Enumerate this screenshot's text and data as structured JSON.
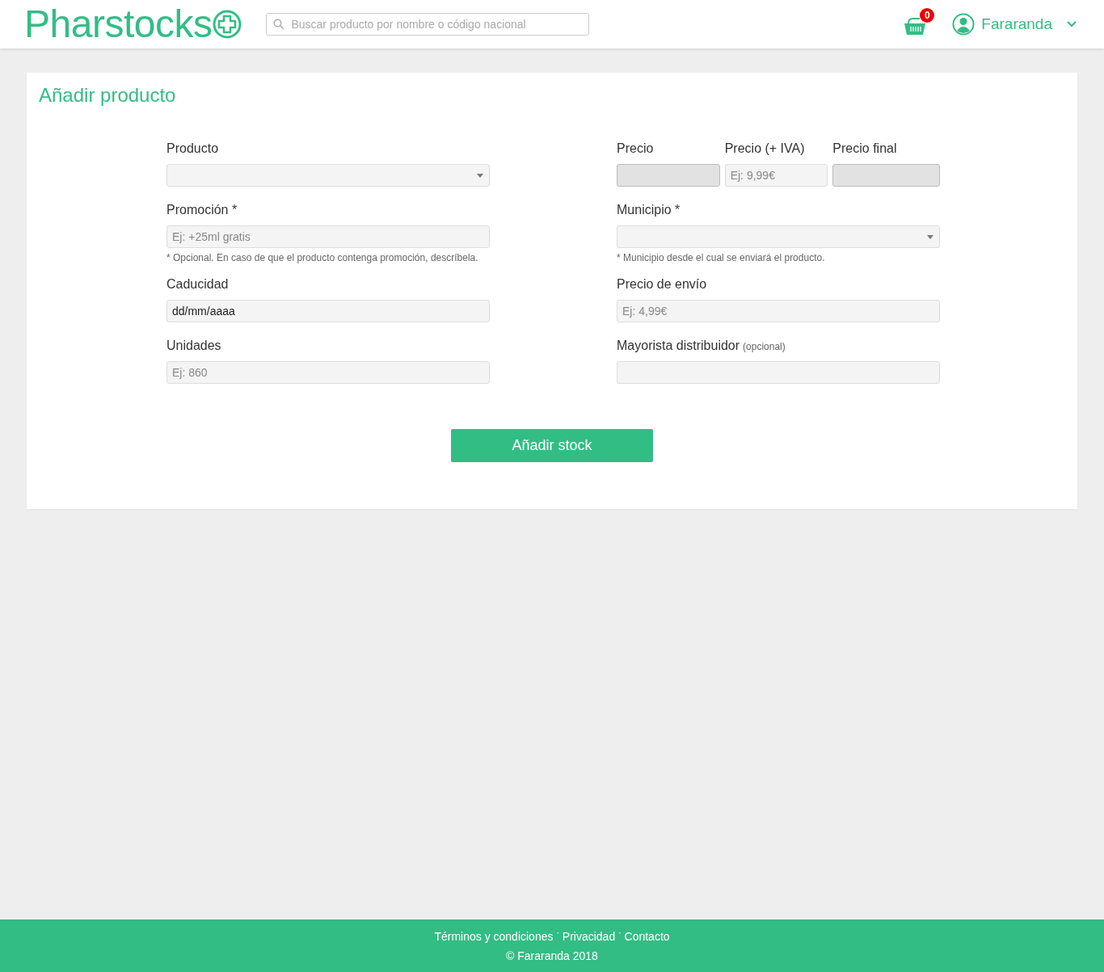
{
  "header": {
    "logo": "Pharstocks",
    "search": {
      "placeholder": "Buscar producto por nombre o código nacional"
    },
    "cart_count": "0",
    "user": "Fararanda"
  },
  "card": {
    "title": "Añadir producto",
    "left": [
      {
        "kind": "select",
        "label": "Producto"
      },
      {
        "kind": "text",
        "label": "Promoción *",
        "placeholder": "Ej: +25ml gratis",
        "help": "* Opcional. En caso de que el producto contenga promoción, descríbela."
      },
      {
        "kind": "text",
        "label": "Caducidad",
        "value": "dd/mm/aaaa"
      },
      {
        "kind": "text",
        "label": "Unidades",
        "placeholder": "Ej: 860"
      }
    ],
    "right": [
      {
        "kind": "prices",
        "items": [
          {
            "label": "Precio",
            "disabled": true
          },
          {
            "label": "Precio (+ IVA)",
            "placeholder": "Ej: 9,99€",
            "disabled": false
          },
          {
            "label": "Precio final",
            "disabled": true
          }
        ]
      },
      {
        "kind": "select",
        "label": "Municipio *",
        "help": "* Municipio desde el cual se enviará el producto."
      },
      {
        "kind": "text",
        "label": "Precio de envío",
        "placeholder": "Ej: 4,99€"
      },
      {
        "kind": "text",
        "label": "Mayorista distribuidor",
        "note": "(opcional)"
      }
    ],
    "submit": "Añadir stock"
  },
  "footer": {
    "links": [
      "Términos y condiciones",
      "Privacidad",
      "Contacto"
    ],
    "separator": "·",
    "copyright": "© Fararanda 2018"
  }
}
